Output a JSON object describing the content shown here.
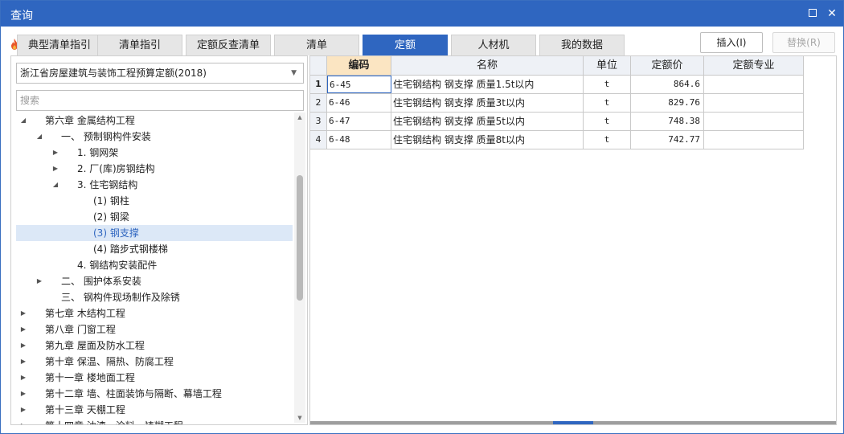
{
  "window": {
    "title": "查询"
  },
  "tabs": [
    {
      "label": "典型清单指引"
    },
    {
      "label": "清单指引"
    },
    {
      "label": "定额反查清单"
    },
    {
      "label": "清单"
    },
    {
      "label": "定额",
      "active": true
    },
    {
      "label": "人材机"
    },
    {
      "label": "我的数据"
    }
  ],
  "actions": {
    "insert": "插入(I)",
    "replace": "替换(R)"
  },
  "left": {
    "norm_selected": "浙江省房屋建筑与装饰工程预算定额(2018)",
    "search_placeholder": "搜索",
    "tree": [
      {
        "label": "第六章 金属结构工程",
        "level": 1,
        "state": "expanded"
      },
      {
        "label": "一、 预制钢构件安装",
        "level": 2,
        "state": "expanded"
      },
      {
        "label": "1. 钢网架",
        "level": 3,
        "state": "collapsed"
      },
      {
        "label": "2. 厂(库)房钢结构",
        "level": 3,
        "state": "collapsed"
      },
      {
        "label": "3. 住宅钢结构",
        "level": 3,
        "state": "expanded"
      },
      {
        "label": "(1) 钢柱",
        "level": 4,
        "state": "leaf"
      },
      {
        "label": "(2) 钢梁",
        "level": 4,
        "state": "leaf"
      },
      {
        "label": "(3) 钢支撑",
        "level": 4,
        "state": "leaf",
        "selected": true
      },
      {
        "label": "(4) 踏步式钢楼梯",
        "level": 4,
        "state": "leaf"
      },
      {
        "label": "4. 钢结构安装配件",
        "level": 3,
        "state": "leaf"
      },
      {
        "label": "二、 围护体系安装",
        "level": 2,
        "state": "collapsed"
      },
      {
        "label": "三、 钢构件现场制作及除锈",
        "level": 2,
        "state": "leaf"
      },
      {
        "label": "第七章 木结构工程",
        "level": 1,
        "state": "collapsed"
      },
      {
        "label": "第八章 门窗工程",
        "level": 1,
        "state": "collapsed"
      },
      {
        "label": "第九章 屋面及防水工程",
        "level": 1,
        "state": "collapsed"
      },
      {
        "label": "第十章 保温、隔热、防腐工程",
        "level": 1,
        "state": "collapsed"
      },
      {
        "label": "第十一章 楼地面工程",
        "level": 1,
        "state": "collapsed"
      },
      {
        "label": "第十二章 墙、柱面装饰与隔断、幕墙工程",
        "level": 1,
        "state": "collapsed"
      },
      {
        "label": "第十三章 天棚工程",
        "level": 1,
        "state": "collapsed"
      },
      {
        "label": "第十四章 油漆、涂料、裱糊工程",
        "level": 1,
        "state": "collapsed"
      }
    ]
  },
  "grid": {
    "columns": [
      "编码",
      "名称",
      "单位",
      "定额价",
      "定额专业"
    ],
    "rows": [
      {
        "num": "1",
        "code": "6-45",
        "name": "住宅钢结构 钢支撑 质量1.5t以内",
        "unit": "t",
        "price": "864.6",
        "major": ""
      },
      {
        "num": "2",
        "code": "6-46",
        "name": "住宅钢结构 钢支撑 质量3t以内",
        "unit": "t",
        "price": "829.76",
        "major": ""
      },
      {
        "num": "3",
        "code": "6-47",
        "name": "住宅钢结构 钢支撑 质量5t以内",
        "unit": "t",
        "price": "748.38",
        "major": ""
      },
      {
        "num": "4",
        "code": "6-48",
        "name": "住宅钢结构 钢支撑 质量8t以内",
        "unit": "t",
        "price": "742.77",
        "major": ""
      }
    ]
  },
  "colors": {
    "accent": "#2f66c0",
    "sorted_header": "#fbe5c2",
    "selection": "#dce8f7"
  },
  "icons": {
    "logo": "fire-icon",
    "maximize": "maximize-icon",
    "close": "close-icon"
  }
}
